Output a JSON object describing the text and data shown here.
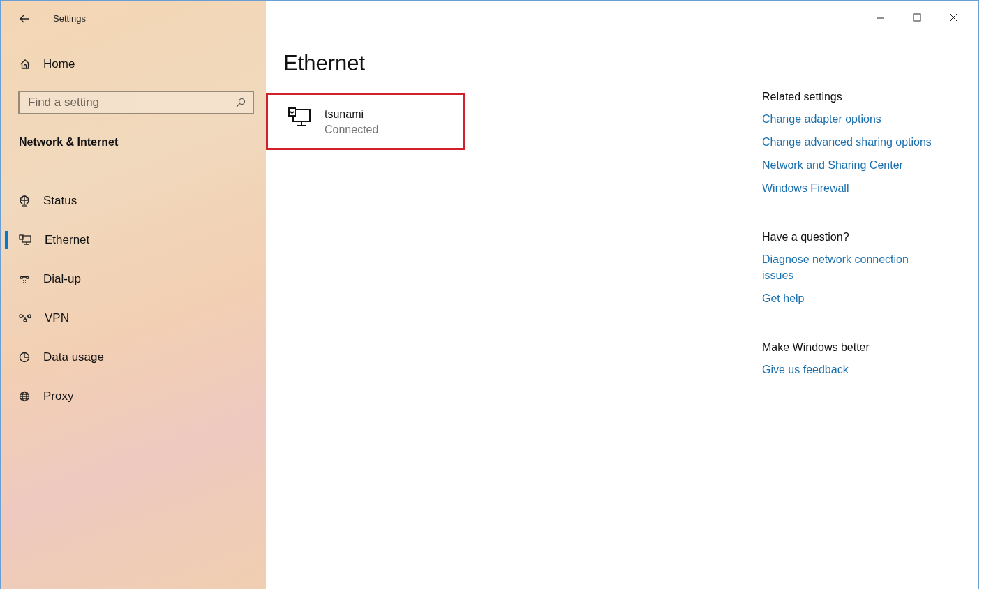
{
  "window": {
    "title": "Settings"
  },
  "sidebar": {
    "home": "Home",
    "search": {
      "placeholder": "Find a setting"
    },
    "section": "Network & Internet",
    "items": [
      {
        "label": "Status",
        "selected": false
      },
      {
        "label": "Ethernet",
        "selected": true
      },
      {
        "label": "Dial-up",
        "selected": false
      },
      {
        "label": "VPN",
        "selected": false
      },
      {
        "label": "Data usage",
        "selected": false
      },
      {
        "label": "Proxy",
        "selected": false
      }
    ]
  },
  "main": {
    "heading": "Ethernet",
    "connection": {
      "name": "tsunami",
      "status": "Connected",
      "highlighted": true
    }
  },
  "related": [
    {
      "title": "Related settings",
      "links": [
        "Change adapter options",
        "Change advanced sharing options",
        "Network and Sharing Center",
        "Windows Firewall"
      ]
    },
    {
      "title": "Have a question?",
      "links": [
        "Diagnose network connection issues",
        "Get help"
      ]
    },
    {
      "title": "Make Windows better",
      "links": [
        "Give us feedback"
      ]
    }
  ]
}
